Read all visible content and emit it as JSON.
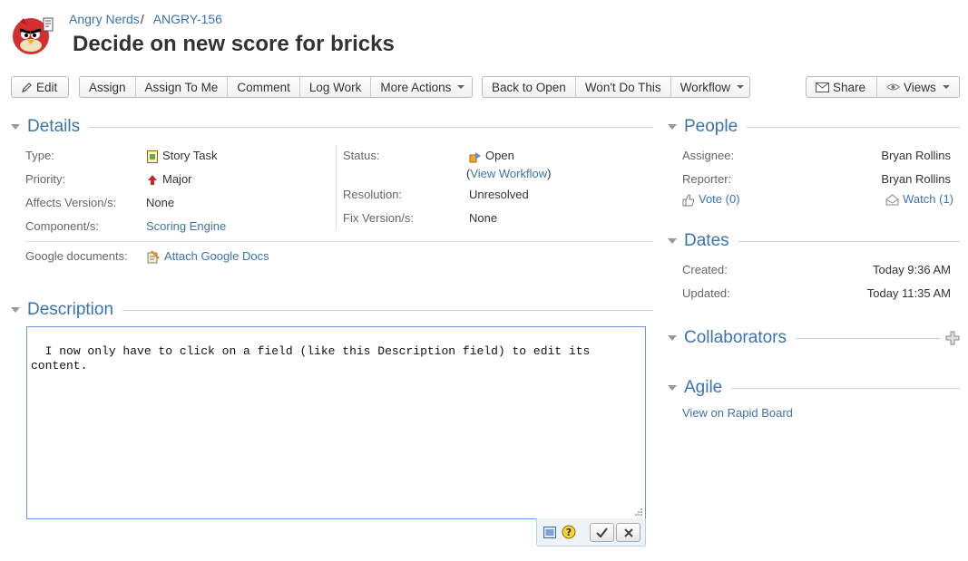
{
  "header": {
    "project": "Angry Nerds",
    "separator": "/",
    "issue_key": "ANGRY-156",
    "title": "Decide on new score for bricks"
  },
  "toolbar": {
    "edit": "Edit",
    "assign": "Assign",
    "assign_to_me": "Assign To Me",
    "comment": "Comment",
    "log_work": "Log Work",
    "more_actions": "More Actions",
    "back_to_open": "Back to Open",
    "wont_do_this": "Won't Do This",
    "workflow": "Workflow",
    "share": "Share",
    "views": "Views"
  },
  "details": {
    "heading": "Details",
    "type_label": "Type:",
    "type_value": "Story Task",
    "priority_label": "Priority:",
    "priority_value": "Major",
    "affects_label": "Affects Version/s:",
    "affects_value": "None",
    "component_label": "Component/s:",
    "component_value": "Scoring Engine",
    "status_label": "Status:",
    "status_value": "Open",
    "workflow_open": "(",
    "workflow_link": "View Workflow",
    "workflow_close": ")",
    "resolution_label": "Resolution:",
    "resolution_value": "Unresolved",
    "fix_label": "Fix Version/s:",
    "fix_value": "None",
    "google_label": "Google documents:",
    "google_link": "Attach Google Docs"
  },
  "description": {
    "heading": "Description",
    "text": "I now only have to click on a field (like this Description field) to edit its\ncontent."
  },
  "people": {
    "heading": "People",
    "assignee_label": "Assignee:",
    "assignee_value": "Bryan Rollins",
    "reporter_label": "Reporter:",
    "reporter_value": "Bryan Rollins",
    "vote": "Vote (0)",
    "watch": "Watch (1)"
  },
  "dates": {
    "heading": "Dates",
    "created_label": "Created:",
    "created_value": "Today 9:36 AM",
    "updated_label": "Updated:",
    "updated_value": "Today 11:35 AM"
  },
  "collaborators": {
    "heading": "Collaborators"
  },
  "agile": {
    "heading": "Agile",
    "link": "View on Rapid Board"
  },
  "colors": {
    "link": "#3b73af",
    "text": "#333333",
    "label": "#666666",
    "focus_border": "#6a9bd8"
  }
}
